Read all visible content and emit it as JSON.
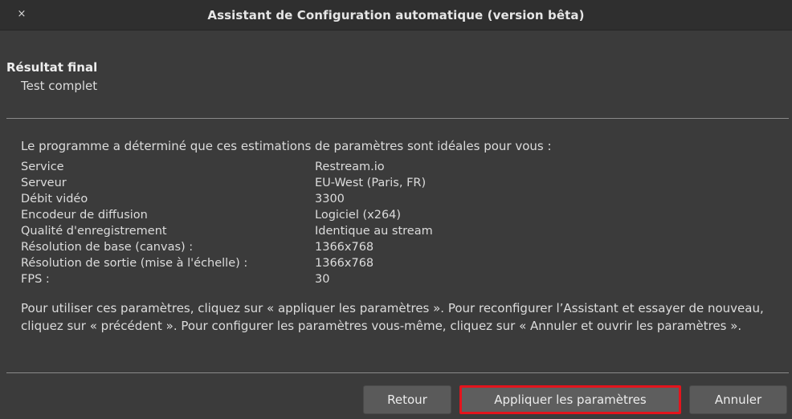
{
  "window": {
    "title": "Assistant de Configuration automatique (version bêta)",
    "close_glyph": "×"
  },
  "result": {
    "heading": "Résultat final",
    "status": "Test complet"
  },
  "intro": "Le programme a déterminé que ces estimations de paramètres sont idéales pour vous :",
  "settings": [
    {
      "key": "Service",
      "value": "Restream.io"
    },
    {
      "key": "Serveur",
      "value": "EU-West (Paris, FR)"
    },
    {
      "key": "Débit vidéo",
      "value": "3300"
    },
    {
      "key": "Encodeur de diffusion",
      "value": "Logiciel (x264)"
    },
    {
      "key": "Qualité d'enregistrement",
      "value": "Identique au stream"
    },
    {
      "key": "Résolution de base (canvas) :",
      "value": "1366x768"
    },
    {
      "key": "Résolution de sortie (mise à l'échelle) :",
      "value": "1366x768"
    },
    {
      "key": "FPS :",
      "value": "30"
    }
  ],
  "note": "Pour utiliser ces paramètres, cliquez sur « appliquer les paramètres ». Pour reconfigurer l’Assistant et essayer de nouveau, cliquez sur « précédent ». Pour configurer les paramètres vous-même, cliquez sur « Annuler et ouvrir les paramètres ».",
  "buttons": {
    "back": "Retour",
    "apply": "Appliquer les paramètres",
    "cancel": "Annuler"
  },
  "colors": {
    "highlight": "#e3141d"
  }
}
